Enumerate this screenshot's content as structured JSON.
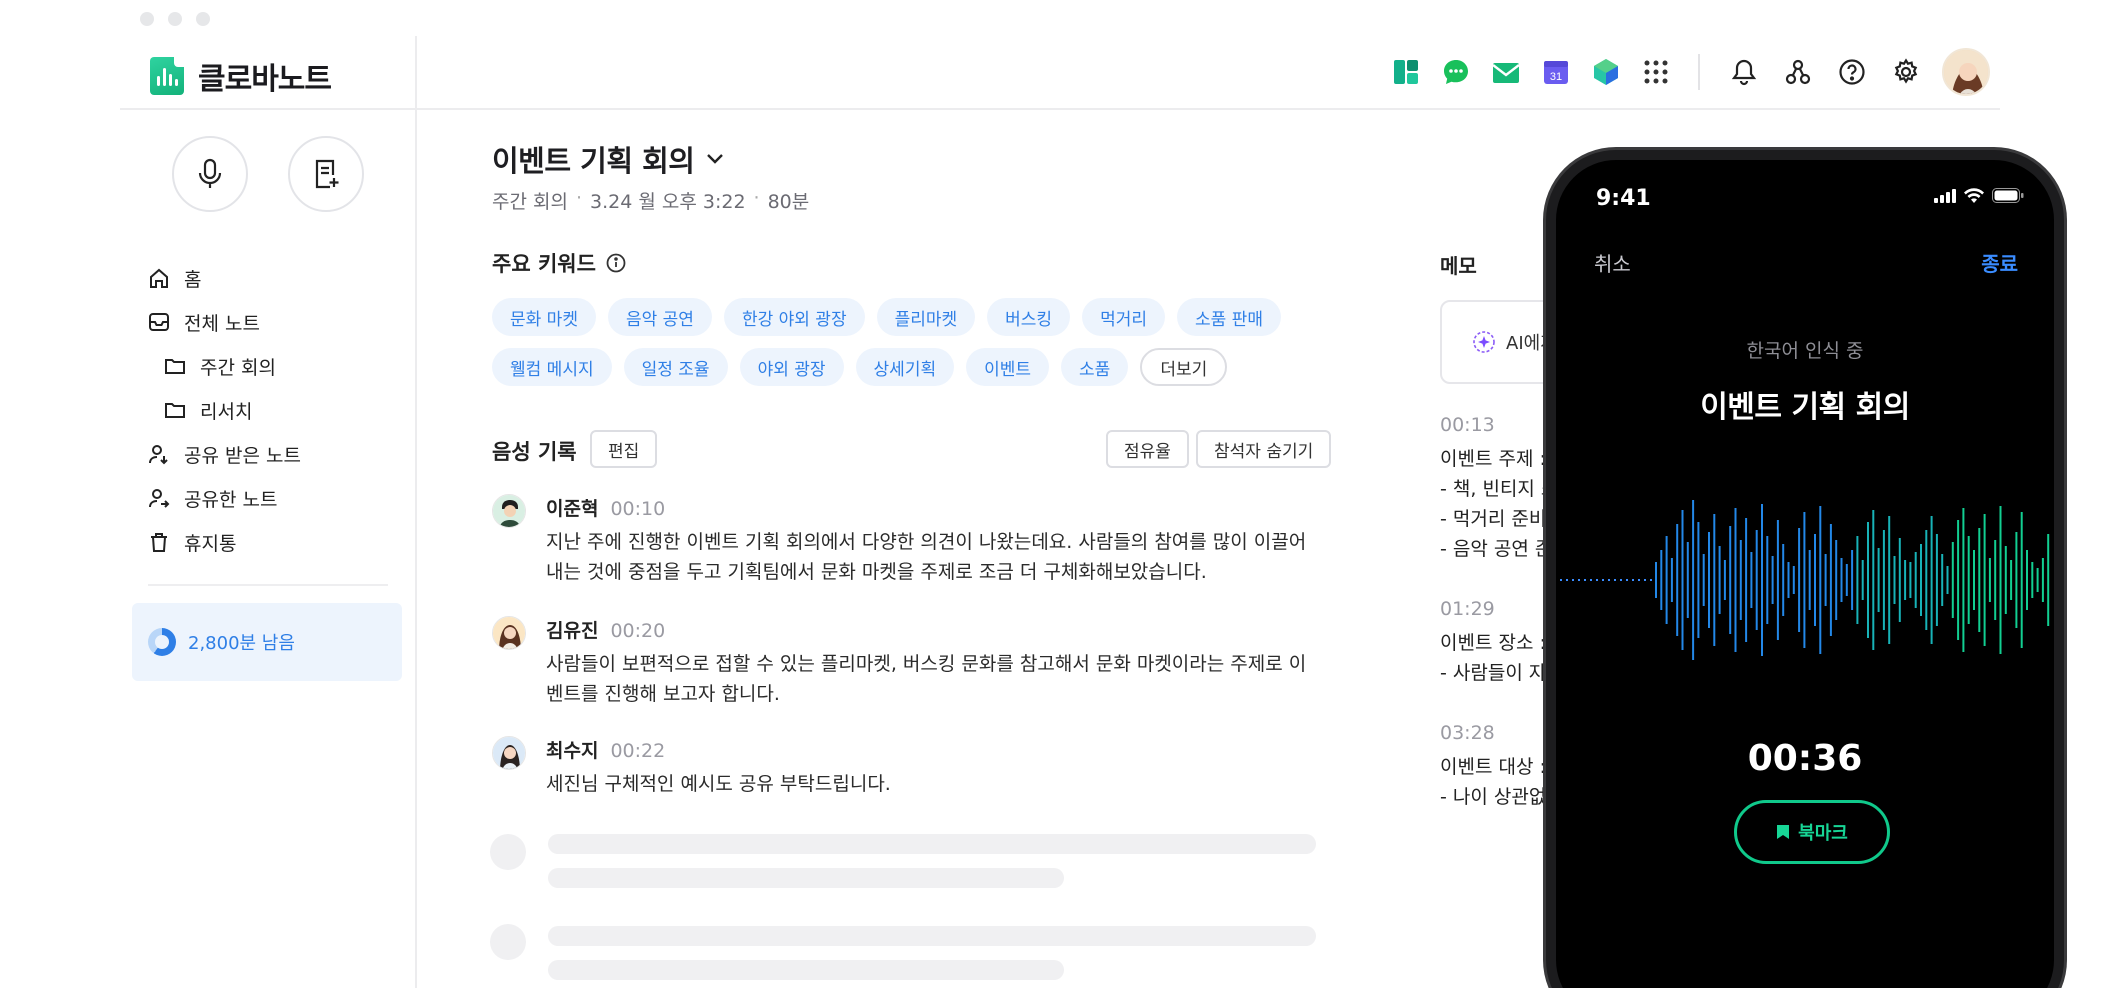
{
  "app": {
    "name": "클로바노트",
    "brand_color": "#13b27a",
    "accent_color": "#2f7fe6"
  },
  "header": {
    "apps": [
      "dashboard-icon",
      "chat-icon",
      "mail-icon",
      "calendar-icon",
      "cube-icon",
      "apps-grid-icon"
    ],
    "calendar_day": "31",
    "tools": [
      "bell-icon",
      "share-network-icon",
      "help-icon",
      "gear-icon"
    ]
  },
  "sidebar": {
    "items": [
      {
        "label": "홈",
        "icon": "home-icon"
      },
      {
        "label": "전체 노트",
        "icon": "inbox-icon"
      },
      {
        "label": "주간 회의",
        "icon": "folder-icon"
      },
      {
        "label": "리서치",
        "icon": "folder-icon"
      },
      {
        "label": "공유 받은 노트",
        "icon": "user-received-icon"
      },
      {
        "label": "공유한 노트",
        "icon": "user-shared-icon"
      },
      {
        "label": "휴지통",
        "icon": "trash-icon"
      }
    ],
    "quota": "2,800분 남음"
  },
  "note": {
    "title": "이벤트 기획 회의",
    "folder": "주간 회의",
    "date": "3.24 월 오후 3:22",
    "duration": "80분",
    "keywords_label": "주요 키워드",
    "keywords": [
      "문화 마켓",
      "음악 공연",
      "한강 야외 광장",
      "플리마켓",
      "버스킹",
      "먹거리",
      "소품 판매",
      "웰컴 메시지",
      "일정 조율",
      "야외 광장",
      "상세기획",
      "이벤트",
      "소품"
    ],
    "more_label": "더보기",
    "record_label": "음성 기록",
    "edit_label": "편집",
    "share_rate_label": "점유율",
    "hide_participants_label": "참석자 숨기기",
    "utterances": [
      {
        "name": "이준혁",
        "time": "00:10",
        "text": "지난 주에 진행한 이벤트 기획 회의에서 다양한 의견이 나왔는데요. 사람들의 참여를 많이 이끌어내는 것에 중점을 두고 기획팀에서 문화 마켓을 주제로 조금 더 구체화해보았습니다."
      },
      {
        "name": "김유진",
        "time": "00:20",
        "text": "사람들이 보편적으로 접할 수 있는 플리마켓, 버스킹 문화를 참고해서 문화 마켓이라는 주제로 이벤트를 진행해 보고자 합니다."
      },
      {
        "name": "최수지",
        "time": "00:22",
        "text": "세진님 구체적인 예시도 공유 부탁드립니다."
      }
    ]
  },
  "memo": {
    "label": "메모",
    "ai_label": "AI에게",
    "entries": [
      {
        "time": "00:13",
        "lines": [
          "이벤트 주제 :",
          "- 책, 빈티지 소",
          "- 먹거리 준비",
          "- 음악 공연 준"
        ]
      },
      {
        "time": "01:29",
        "lines": [
          "이벤트 장소 :",
          "- 사람들이 자"
        ]
      },
      {
        "time": "03:28",
        "lines": [
          "이벤트 대상 :",
          "- 나이 상관없"
        ]
      }
    ]
  },
  "phone": {
    "clock": "9:41",
    "cancel": "취소",
    "end": "종료",
    "status": "한국어 인식 중",
    "title": "이벤트 기획 회의",
    "timer": "00:36",
    "bookmark": "북마크"
  }
}
